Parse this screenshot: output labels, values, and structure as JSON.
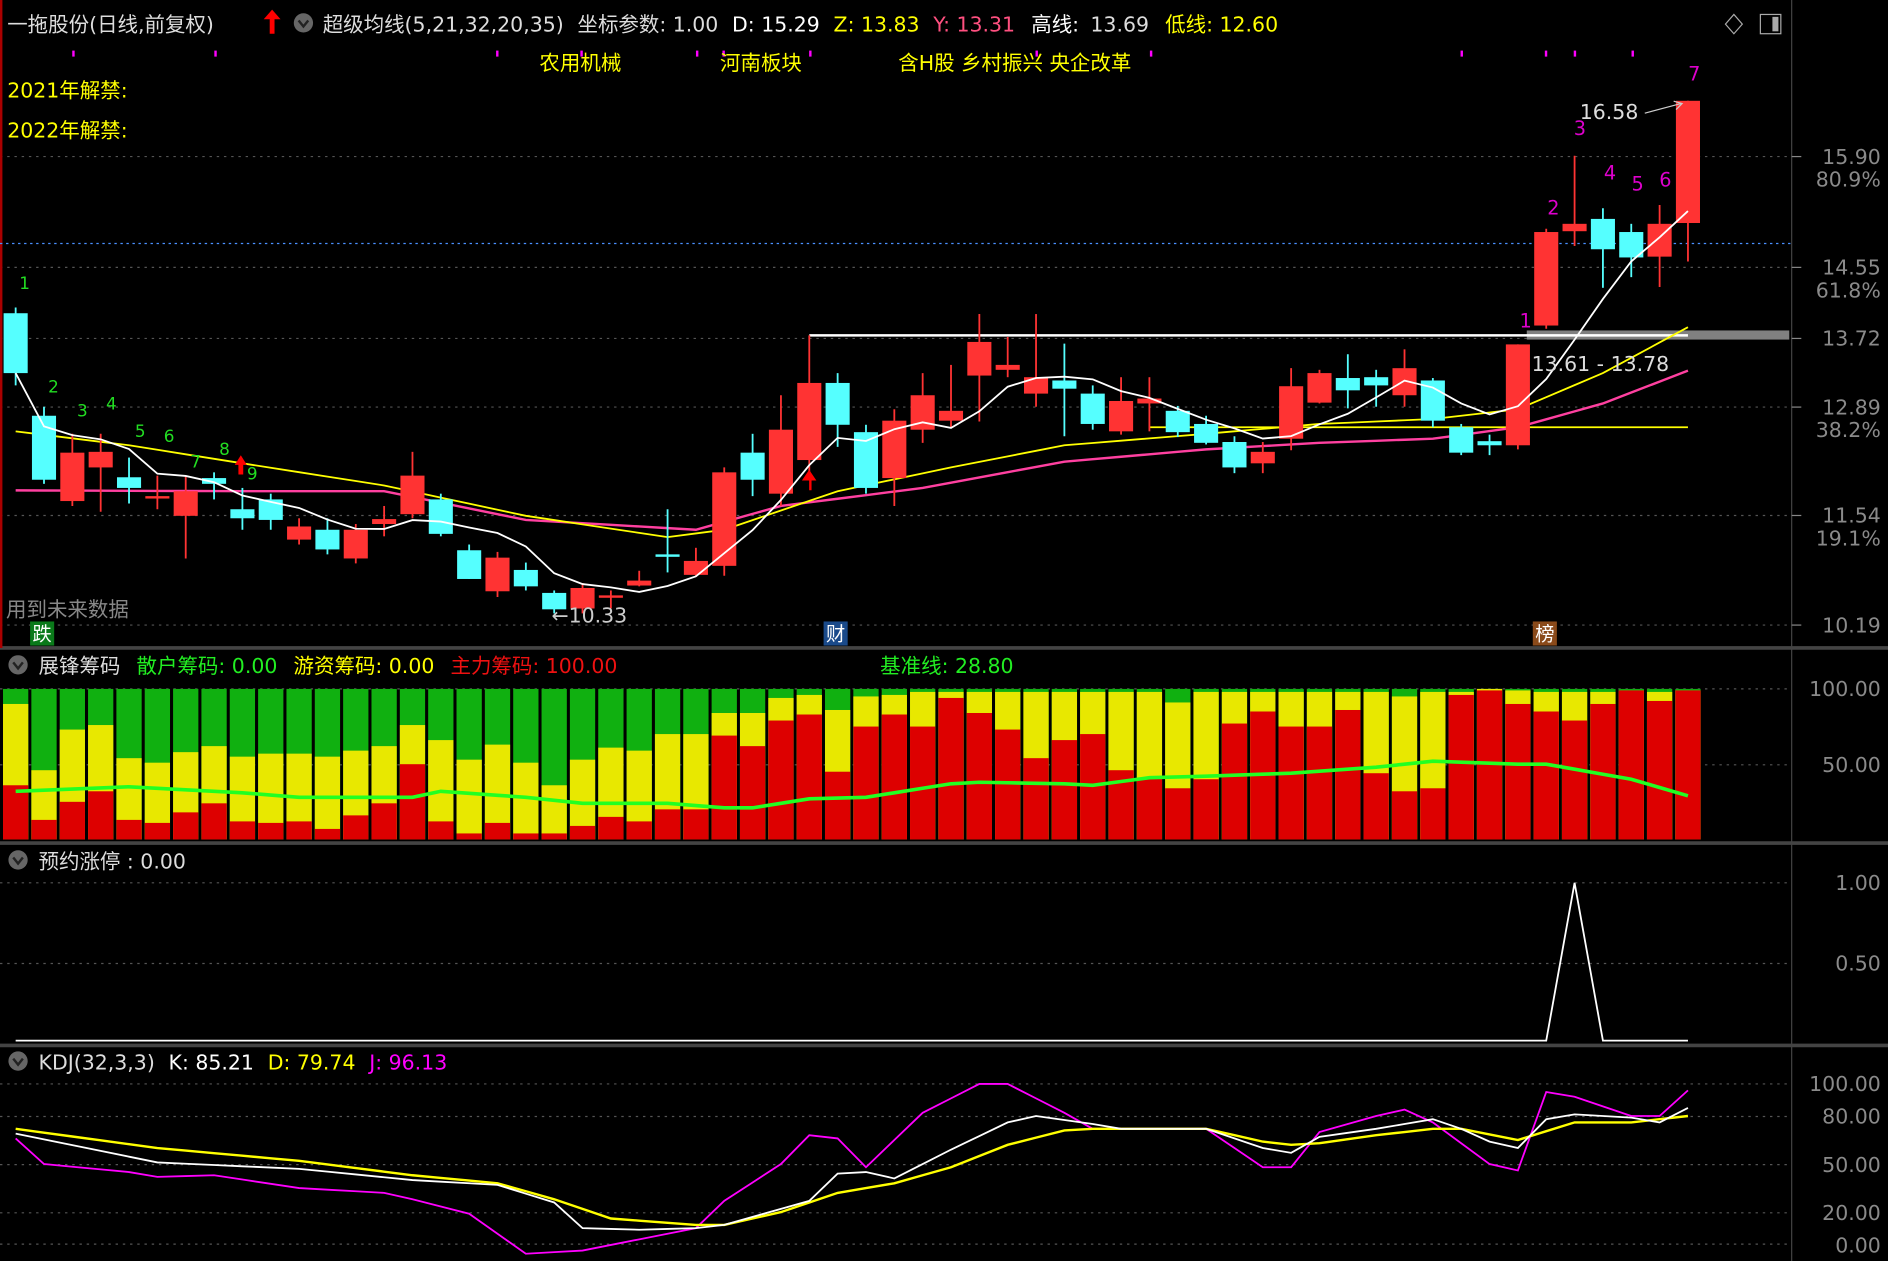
{
  "header": {
    "title": "一拖股份(日线,前复权)",
    "indicator": "超级均线(5,21,32,20,35)",
    "coord_label": "坐标参数: 1.00",
    "d_label": "D: 15.29",
    "z_label": "Z: 13.83",
    "y_label": "Y: 13.31",
    "high_label": "高线:",
    "high_value": "13.69",
    "low_label": "低线: 12.60"
  },
  "tags": [
    "农用机械",
    "河南板块",
    "含H股 乡村振兴 央企改革"
  ],
  "unlock": [
    "2021年解禁:",
    "2022年解禁:"
  ],
  "notes": {
    "future_data": "用到未来数据",
    "low_mark": "←10.33",
    "high_mark": "16.58",
    "range_mark": "13.61 - 13.78"
  },
  "badges": [
    {
      "text": "跌",
      "color": "#0a7a1a"
    },
    {
      "text": "财",
      "color": "#1a4a8a"
    },
    {
      "text": "榜",
      "color": "#8a4a1a"
    }
  ],
  "green_counts": [
    "1",
    "2",
    "3",
    "4",
    "5",
    "6",
    "7",
    "8",
    "9"
  ],
  "magenta_counts": [
    "1",
    "2",
    "3",
    "4",
    "5",
    "6",
    "7"
  ],
  "price_axis": [
    {
      "v": "15.90",
      "p": "80.9%"
    },
    {
      "v": "14.55",
      "p": "61.8%"
    },
    {
      "v": "13.72",
      "p": ""
    },
    {
      "v": "12.89",
      "p": "38.2%"
    },
    {
      "v": "11.54",
      "p": "19.1%"
    },
    {
      "v": "10.19",
      "p": ""
    }
  ],
  "chip_panel": {
    "name": "展锋筹码",
    "retail": "散户筹码: 0.00",
    "hot": "游资筹码: 0.00",
    "main": "主力筹码: 100.00",
    "base": "基准线: 28.80",
    "axis": [
      "100.00",
      "50.00"
    ]
  },
  "limit_panel": {
    "name": "预约涨停 : 0.00",
    "axis": [
      "1.00",
      "0.50"
    ]
  },
  "kdj_panel": {
    "name": "KDJ(32,3,3)",
    "k": "K: 85.21",
    "d": "D: 79.74",
    "j": "J: 96.13",
    "axis": [
      "100.00",
      "80.00",
      "50.00",
      "20.00",
      "0.00"
    ]
  },
  "colors": {
    "up": "#ff3333",
    "down": "#55ffff",
    "ma5": "#ffffff",
    "ma_yellow": "#ffff00",
    "ma_pink": "#ff40a0",
    "chip_main": "#dd0000",
    "chip_hot": "#e8e800",
    "chip_retail": "#10b010",
    "base_line": "#22ff22",
    "k": "#ffffff",
    "d": "#ffff00",
    "j": "#ff00ff"
  },
  "chart_data": {
    "type": "candlestick",
    "price_range": [
      10.19,
      15.9
    ],
    "ohlc": [
      [
        13.99,
        14.06,
        13.11,
        13.26
      ],
      [
        12.74,
        12.85,
        11.91,
        11.96
      ],
      [
        11.7,
        12.52,
        11.64,
        12.29
      ],
      [
        12.11,
        12.52,
        11.57,
        12.3
      ],
      [
        11.99,
        12.23,
        11.67,
        11.86
      ],
      [
        11.74,
        12.01,
        11.6,
        11.76
      ],
      [
        11.52,
        12.01,
        11.0,
        11.82
      ],
      [
        11.98,
        12.05,
        11.72,
        11.91
      ],
      [
        11.6,
        11.86,
        11.35,
        11.49
      ],
      [
        11.72,
        11.79,
        11.35,
        11.47
      ],
      [
        11.23,
        11.49,
        11.17,
        11.39
      ],
      [
        11.35,
        11.49,
        11.05,
        11.11
      ],
      [
        11.0,
        11.42,
        10.94,
        11.35
      ],
      [
        11.42,
        11.64,
        11.27,
        11.48
      ],
      [
        11.54,
        12.3,
        11.49,
        12.01
      ],
      [
        11.72,
        11.79,
        11.27,
        11.3
      ],
      [
        11.1,
        11.17,
        10.75,
        10.75
      ],
      [
        10.6,
        11.08,
        10.53,
        11.01
      ],
      [
        10.86,
        10.95,
        10.61,
        10.66
      ],
      [
        10.58,
        10.61,
        10.33,
        10.38
      ],
      [
        10.39,
        10.7,
        10.33,
        10.64
      ],
      [
        10.53,
        10.61,
        10.39,
        10.55
      ],
      [
        10.67,
        10.85,
        10.66,
        10.73
      ],
      [
        11.05,
        11.6,
        10.83,
        11.02
      ],
      [
        10.8,
        11.13,
        10.79,
        10.97
      ],
      [
        10.91,
        12.11,
        10.79,
        12.05
      ],
      [
        12.29,
        12.52,
        11.76,
        11.96
      ],
      [
        11.79,
        12.99,
        11.64,
        12.57
      ],
      [
        12.2,
        13.72,
        12.01,
        13.14
      ],
      [
        13.14,
        13.26,
        12.36,
        12.63
      ],
      [
        12.54,
        12.63,
        11.79,
        11.86
      ],
      [
        11.98,
        12.82,
        11.64,
        12.68
      ],
      [
        12.57,
        13.26,
        12.41,
        12.99
      ],
      [
        12.68,
        13.36,
        12.6,
        12.8
      ],
      [
        13.23,
        13.98,
        12.67,
        13.64
      ],
      [
        13.3,
        13.7,
        13.21,
        13.36
      ],
      [
        13.01,
        13.98,
        12.85,
        13.21
      ],
      [
        13.17,
        13.62,
        12.49,
        13.07
      ],
      [
        13.01,
        13.11,
        12.57,
        12.64
      ],
      [
        12.55,
        13.21,
        12.51,
        12.92
      ],
      [
        12.89,
        13.21,
        12.55,
        12.95
      ],
      [
        12.8,
        12.86,
        12.48,
        12.54
      ],
      [
        12.64,
        12.74,
        12.39,
        12.41
      ],
      [
        12.42,
        12.49,
        12.04,
        12.11
      ],
      [
        12.16,
        12.42,
        12.04,
        12.3
      ],
      [
        12.46,
        13.32,
        12.32,
        13.1
      ],
      [
        12.9,
        13.3,
        12.89,
        13.26
      ],
      [
        13.2,
        13.49,
        12.83,
        13.05
      ],
      [
        13.21,
        13.3,
        12.85,
        13.11
      ],
      [
        12.99,
        13.55,
        12.85,
        13.32
      ],
      [
        13.17,
        13.2,
        12.6,
        12.68
      ],
      [
        12.6,
        12.64,
        12.26,
        12.29
      ],
      [
        12.43,
        12.51,
        12.26,
        12.38
      ],
      [
        12.38,
        13.61,
        12.33,
        13.61
      ],
      [
        13.84,
        15.02,
        13.8,
        14.98
      ],
      [
        14.99,
        15.91,
        14.81,
        15.08
      ],
      [
        15.14,
        15.27,
        14.3,
        14.77
      ],
      [
        14.98,
        15.08,
        14.43,
        14.67
      ],
      [
        14.68,
        15.31,
        14.31,
        15.08
      ],
      [
        15.09,
        16.58,
        14.62,
        16.58
      ]
    ],
    "ma_yellow": [
      [
        0,
        12.55
      ],
      [
        4,
        12.38
      ],
      [
        8,
        12.16
      ],
      [
        13,
        11.89
      ],
      [
        18,
        11.52
      ],
      [
        23,
        11.26
      ],
      [
        25,
        11.35
      ],
      [
        29,
        11.82
      ],
      [
        33,
        12.11
      ],
      [
        37,
        12.38
      ],
      [
        42,
        12.52
      ],
      [
        46,
        12.64
      ],
      [
        50,
        12.7
      ],
      [
        53,
        12.82
      ],
      [
        56,
        13.26
      ],
      [
        59,
        13.82
      ]
    ],
    "ma_pink": [
      [
        0,
        11.83
      ],
      [
        8,
        11.82
      ],
      [
        13,
        11.82
      ],
      [
        18,
        11.47
      ],
      [
        24,
        11.35
      ],
      [
        27,
        11.64
      ],
      [
        32,
        11.86
      ],
      [
        37,
        12.18
      ],
      [
        42,
        12.33
      ],
      [
        46,
        12.41
      ],
      [
        50,
        12.46
      ],
      [
        53,
        12.6
      ],
      [
        56,
        12.89
      ],
      [
        59,
        13.29
      ]
    ],
    "resistance": 13.72,
    "support_band": [
      13.61,
      13.78
    ],
    "low_line": 12.6,
    "ref_line": 14.84,
    "chip_main_pct": [
      36,
      13,
      25,
      32,
      13,
      11,
      18,
      24,
      12,
      11,
      12,
      7,
      16,
      24,
      50,
      12,
      4,
      11,
      4,
      4,
      9,
      15,
      12,
      20,
      20,
      69,
      62,
      79,
      83,
      45,
      75,
      83,
      75,
      94,
      84,
      73,
      54,
      66,
      70,
      46,
      41,
      34,
      40,
      77,
      85,
      75,
      75,
      86,
      44,
      32,
      34,
      96,
      99,
      90,
      85,
      79,
      90,
      99,
      92,
      99
    ],
    "chip_hot_pct": [
      90,
      46,
      73,
      76,
      54,
      51,
      58,
      62,
      55,
      57,
      57,
      55,
      59,
      62,
      76,
      66,
      53,
      63,
      51,
      36,
      53,
      61,
      59,
      70,
      70,
      84,
      84,
      94,
      96,
      86,
      95,
      96,
      98,
      98,
      98,
      98,
      98,
      98,
      98,
      98,
      98,
      91,
      98,
      98,
      98,
      98,
      98,
      98,
      98,
      95,
      98,
      98,
      100,
      99,
      98,
      98,
      98,
      99,
      98,
      99
    ],
    "base_line": [
      [
        0,
        32
      ],
      [
        4,
        35
      ],
      [
        8,
        31
      ],
      [
        10,
        28
      ],
      [
        14,
        28
      ],
      [
        15,
        32
      ],
      [
        18,
        28
      ],
      [
        20,
        24
      ],
      [
        23,
        24
      ],
      [
        25,
        21
      ],
      [
        26,
        21
      ],
      [
        28,
        27
      ],
      [
        30,
        28
      ],
      [
        33,
        37
      ],
      [
        34,
        38
      ],
      [
        37,
        37
      ],
      [
        38,
        36
      ],
      [
        40,
        41
      ],
      [
        42,
        42
      ],
      [
        45,
        44
      ],
      [
        48,
        48
      ],
      [
        50,
        52
      ],
      [
        53,
        50
      ],
      [
        54,
        50
      ],
      [
        57,
        40
      ],
      [
        59,
        29
      ]
    ],
    "limit_signal": [
      [
        0,
        0
      ],
      [
        54,
        0
      ],
      [
        55,
        1
      ],
      [
        56,
        0
      ],
      [
        59,
        0
      ]
    ],
    "kdj_k": [
      [
        0,
        69
      ],
      [
        5,
        51
      ],
      [
        10,
        47
      ],
      [
        14,
        40
      ],
      [
        17,
        37
      ],
      [
        19,
        26
      ],
      [
        20,
        10
      ],
      [
        22,
        9
      ],
      [
        24,
        10
      ],
      [
        25,
        12
      ],
      [
        28,
        27
      ],
      [
        29,
        44
      ],
      [
        30,
        45
      ],
      [
        31,
        41
      ],
      [
        33,
        59
      ],
      [
        35,
        76
      ],
      [
        36,
        80
      ],
      [
        38,
        75
      ],
      [
        39,
        72
      ],
      [
        42,
        72
      ],
      [
        44,
        60
      ],
      [
        45,
        57
      ],
      [
        46,
        67
      ],
      [
        48,
        72
      ],
      [
        50,
        78
      ],
      [
        51,
        72
      ],
      [
        52,
        64
      ],
      [
        53,
        60
      ],
      [
        54,
        78
      ],
      [
        55,
        81
      ],
      [
        57,
        79
      ],
      [
        58,
        76
      ],
      [
        59,
        85
      ]
    ],
    "kdj_d": [
      [
        0,
        72
      ],
      [
        5,
        60
      ],
      [
        10,
        52
      ],
      [
        14,
        43
      ],
      [
        17,
        38
      ],
      [
        19,
        28
      ],
      [
        21,
        16
      ],
      [
        24,
        12
      ],
      [
        25,
        12
      ],
      [
        27,
        20
      ],
      [
        29,
        32
      ],
      [
        31,
        38
      ],
      [
        33,
        48
      ],
      [
        35,
        62
      ],
      [
        37,
        71
      ],
      [
        38,
        72
      ],
      [
        42,
        72
      ],
      [
        44,
        64
      ],
      [
        45,
        62
      ],
      [
        46,
        63
      ],
      [
        48,
        68
      ],
      [
        50,
        72
      ],
      [
        51,
        72
      ],
      [
        53,
        65
      ],
      [
        55,
        76
      ],
      [
        57,
        76
      ],
      [
        59,
        80
      ]
    ],
    "kdj_j": [
      [
        0,
        66
      ],
      [
        1,
        50
      ],
      [
        4,
        45
      ],
      [
        5,
        42
      ],
      [
        7,
        43
      ],
      [
        10,
        35
      ],
      [
        13,
        32
      ],
      [
        14,
        28
      ],
      [
        16,
        19
      ],
      [
        18,
        -6
      ],
      [
        20,
        -4
      ],
      [
        24,
        10
      ],
      [
        25,
        27
      ],
      [
        27,
        50
      ],
      [
        28,
        68
      ],
      [
        29,
        66
      ],
      [
        30,
        48
      ],
      [
        32,
        82
      ],
      [
        34,
        100
      ],
      [
        35,
        100
      ],
      [
        37,
        82
      ],
      [
        38,
        72
      ],
      [
        42,
        72
      ],
      [
        44,
        48
      ],
      [
        45,
        48
      ],
      [
        46,
        70
      ],
      [
        48,
        80
      ],
      [
        49,
        84
      ],
      [
        50,
        76
      ],
      [
        52,
        50
      ],
      [
        53,
        46
      ],
      [
        54,
        95
      ],
      [
        55,
        92
      ],
      [
        57,
        80
      ],
      [
        58,
        80
      ],
      [
        59,
        96
      ]
    ]
  }
}
